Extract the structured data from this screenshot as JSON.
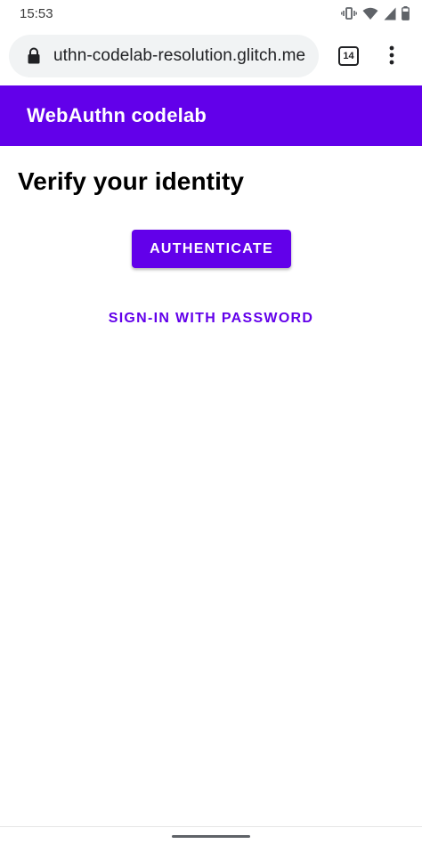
{
  "status_bar": {
    "time": "15:53",
    "icons": [
      "vibrate-icon",
      "wifi-icon",
      "signal-icon",
      "battery-icon"
    ]
  },
  "browser": {
    "url": "uthn-codelab-resolution.glitch.me",
    "tab_count": "14",
    "icons": [
      "lock-icon",
      "tab-switcher-icon",
      "more-vert-icon"
    ]
  },
  "app_bar": {
    "title": "WebAuthn codelab",
    "color": "#6200ea"
  },
  "main": {
    "heading": "Verify your identity",
    "authenticate_label": "AUTHENTICATE",
    "password_link_label": "SIGN-IN WITH PASSWORD"
  },
  "colors": {
    "primary": "#6200ea",
    "on_primary": "#ffffff",
    "omnibox_bg": "#f1f3f4"
  }
}
